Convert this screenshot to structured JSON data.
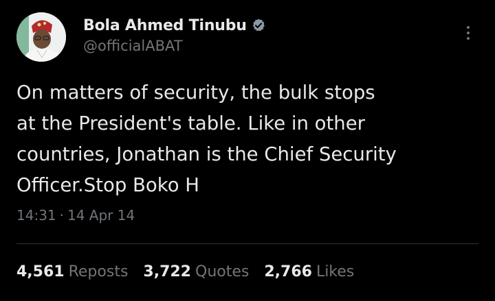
{
  "author": {
    "display_name": "Bola Ahmed Tinubu",
    "handle": "@officialABAT",
    "verified": true,
    "verified_color": "#8b98a5",
    "avatar_icon": "profile-photo"
  },
  "tweet": {
    "text_lines": [
      "On matters of security, the bulk stops",
      "at the President's table. Like in other",
      "countries, Jonathan is the Chief Security",
      "Officer.Stop Boko H"
    ],
    "time": "14:31",
    "separator": "·",
    "date": "14 Apr 14"
  },
  "stats": {
    "reposts": {
      "count": "4,561",
      "label": "Reposts"
    },
    "quotes": {
      "count": "3,722",
      "label": "Quotes"
    },
    "likes": {
      "count": "2,766",
      "label": "Likes"
    }
  },
  "colors": {
    "background": "#000000",
    "primary_text": "#e7e9ea",
    "secondary_text": "#71767b",
    "divider": "#2f3336"
  },
  "icons": {
    "verified": "verified-badge-icon",
    "more": "more-options-icon"
  }
}
